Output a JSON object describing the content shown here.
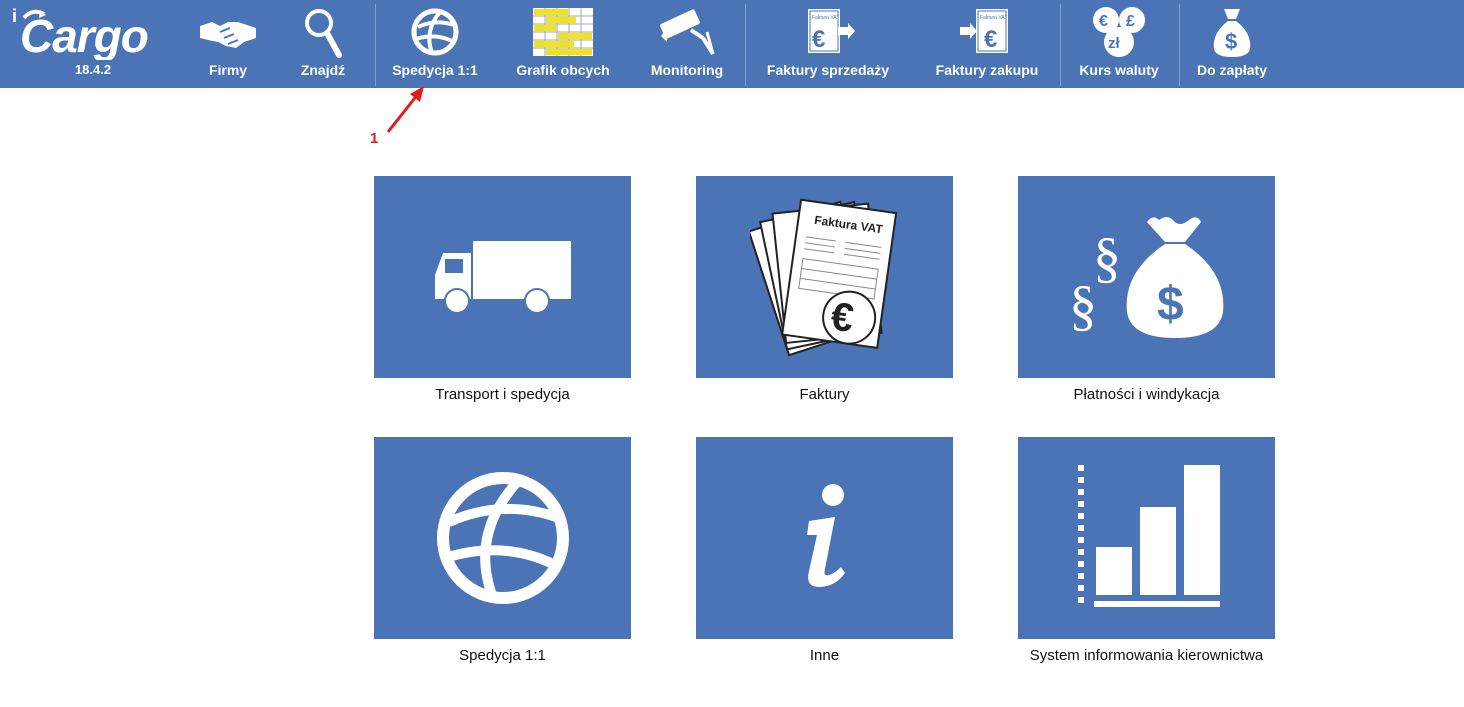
{
  "app": {
    "logo_text": "iCargo",
    "version": "18.4.2"
  },
  "toolbar": {
    "items": [
      {
        "label": "Firmy",
        "icon": "handshake-icon"
      },
      {
        "label": "Znajdź",
        "icon": "magnifier-icon"
      },
      {
        "label": "Spedycja 1:1",
        "icon": "globe-icon"
      },
      {
        "label": "Grafik obcych",
        "icon": "schedule-grid-icon"
      },
      {
        "label": "Monitoring",
        "icon": "camera-icon"
      },
      {
        "label": "Faktury sprzedaży",
        "icon": "sales-invoice-icon"
      },
      {
        "label": "Faktury zakupu",
        "icon": "purchase-invoice-icon"
      },
      {
        "label": "Kurs waluty",
        "icon": "currency-icon"
      },
      {
        "label": "Do zapłaty",
        "icon": "money-bag-icon"
      }
    ]
  },
  "annotation": {
    "number": "1"
  },
  "tiles": [
    {
      "label": "Transport i spedycja",
      "icon": "truck-icon"
    },
    {
      "label": "Faktury",
      "icon": "invoice-documents-icon"
    },
    {
      "label": "Płatności i windykacja",
      "icon": "payments-bag-icon"
    },
    {
      "label": "Spedycja 1:1",
      "icon": "globe-icon"
    },
    {
      "label": "Inne",
      "icon": "info-icon"
    },
    {
      "label": "System informowania kierownictwa",
      "icon": "bar-chart-icon"
    }
  ],
  "colors": {
    "toolbar_bg": "#4a74b5",
    "tile_bg": "#4a74b5",
    "annotation": "#e21b1b",
    "grid_yellow": "#f2e21a"
  }
}
